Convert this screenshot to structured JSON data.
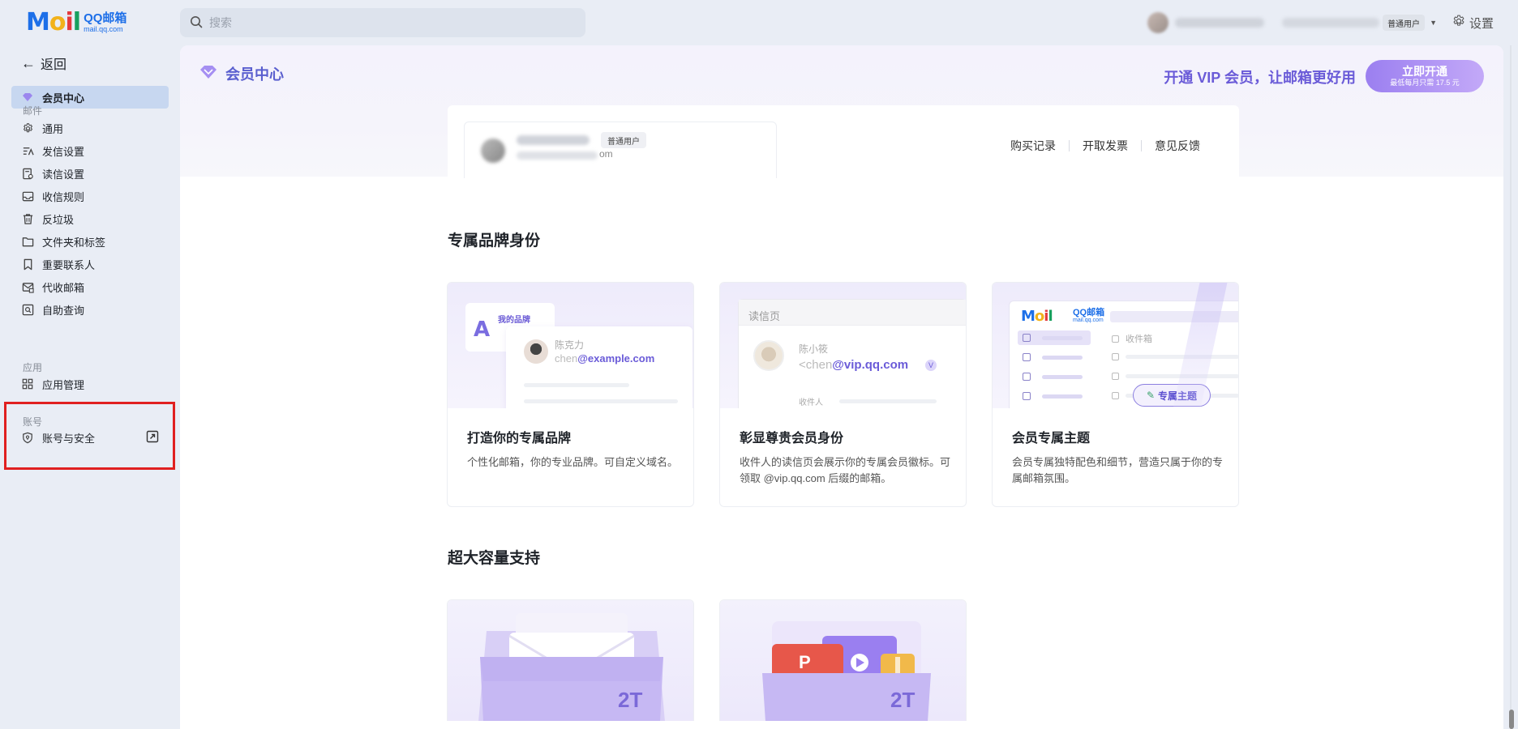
{
  "topbar": {
    "logo_mark": [
      "M",
      "o",
      "i",
      "l"
    ],
    "logo_brand": "QQ邮箱",
    "logo_domain": "mail.qq.com",
    "search_placeholder": "搜索",
    "user_tag": "普通用户",
    "settings_label": "设置"
  },
  "sidebar": {
    "back_label": "返回",
    "member_center": "会员中心",
    "section_mail": "邮件",
    "mail_items": [
      "通用",
      "发信设置",
      "读信设置",
      "收信规则",
      "反垃圾",
      "文件夹和标签",
      "重要联系人",
      "代收邮箱",
      "自助查询"
    ],
    "section_app": "应用",
    "app_items": [
      "应用管理"
    ],
    "section_account": "账号",
    "account_items": [
      "账号与安全"
    ]
  },
  "main": {
    "title": "会员中心",
    "promo_text": "开通 VIP 会员，让邮箱更好用",
    "open_button": "立即开通",
    "open_button_sub": "最低每月只需 17.5 元",
    "profile": {
      "tag": "普通用户",
      "email_tail": "om",
      "links": [
        "购买记录",
        "开取发票",
        "意见反馈"
      ]
    },
    "section1_title": "专属品牌身份",
    "section2_title": "超大容量支持",
    "features": [
      {
        "title": "打造你的专属品牌",
        "desc": "个性化邮箱，你的专业品牌。可自定义域名。",
        "illus": {
          "brand_label": "我的品牌",
          "brand_mark": "A",
          "person_name": "陈克力",
          "mail_prefix": "chen",
          "mail_domain": "@example.com"
        }
      },
      {
        "title": "彰显尊贵会员身份",
        "desc": "收件人的读信页会展示你的专属会员徽标。可领取 @vip.qq.com 后缀的邮箱。",
        "illus": {
          "header": "读信页",
          "person_name": "陈小筱",
          "mail_prefix": "<chen",
          "mail_domain": "@vip.qq.com",
          "vip_badge": "V",
          "to_label": "收件人"
        }
      },
      {
        "title": "会员专属主题",
        "desc": "会员专属独特配色和细节，营造只属于你的专属邮箱氛围。",
        "illus": {
          "logo_mark": [
            "M",
            "o",
            "i",
            "l"
          ],
          "logo_brand": "QQ邮箱",
          "logo_domain": "mail.qq.com",
          "inbox_label": "收件箱",
          "chip_label": "专属主题"
        }
      }
    ],
    "capacity_cards": [
      {
        "badge": "2T"
      },
      {
        "badge": "2T",
        "doc_letter": "P"
      }
    ]
  },
  "colors": {
    "accent": "#6a5bd8",
    "sidebar_active": "#c7d7f0",
    "highlight": "#e02020"
  }
}
